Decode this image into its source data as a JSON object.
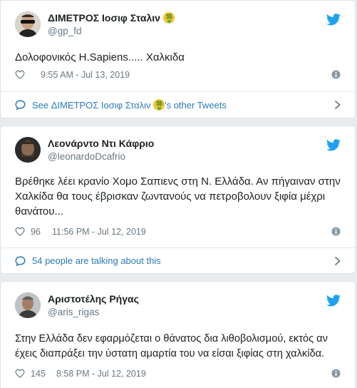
{
  "tweets": [
    {
      "name": "ΔΙΜΕΤΡΟΣ Ιοσιφ Σταλιν",
      "handle": "@gp_fd",
      "text": "Δολοφονικός  H.Sapiens..... Χαλκιδα",
      "likes": "",
      "timestamp": "9:55 AM - Jul 13, 2019",
      "more_prefix": "See ΔΙΜΕΤΡΟΣ Ιοσιφ Σταλιν",
      "more_suffix": "'s other Tweets"
    },
    {
      "name": "Λεονάρντο Ντι Κάφριο",
      "handle": "@leonardoDcafrio",
      "text": "Βρέθηκε λέει κρανίο Χομο Σαπιενς στη Ν. Ελλάδα. Αν πήγαιναν στην Χαλκίδα θα τους έβρισκαν ζωντανούς να πετροβολουν ξιφία μέχρι θανάτου...",
      "likes": "96",
      "timestamp": "11:56 PM - Jul 12, 2019",
      "more_label": "54 people are talking about this"
    },
    {
      "name": "Αριστοτέλης Ρήγας",
      "handle": "@aris_rigas",
      "text": "Στην Ελλάδα δεν εφαρμόζεται ο θάνατος δια λιθοβολισμού, εκτός αν έχεις διαπράξει την ύστατη αμαρτία του να είσαι ξιφίας στη χαλκίδα.",
      "likes": "145",
      "timestamp": "8:58 PM - Jul 12, 2019"
    }
  ],
  "colors": {
    "link": "#2b7bb9",
    "twitter": "#1da1f2",
    "muted": "#697882",
    "text": "#1c2022"
  },
  "icons": [
    "twitter-bird-icon",
    "heart-icon",
    "info-icon",
    "speech-bubble-icon",
    "chevron-right-icon",
    "money-mouth-emoji"
  ]
}
